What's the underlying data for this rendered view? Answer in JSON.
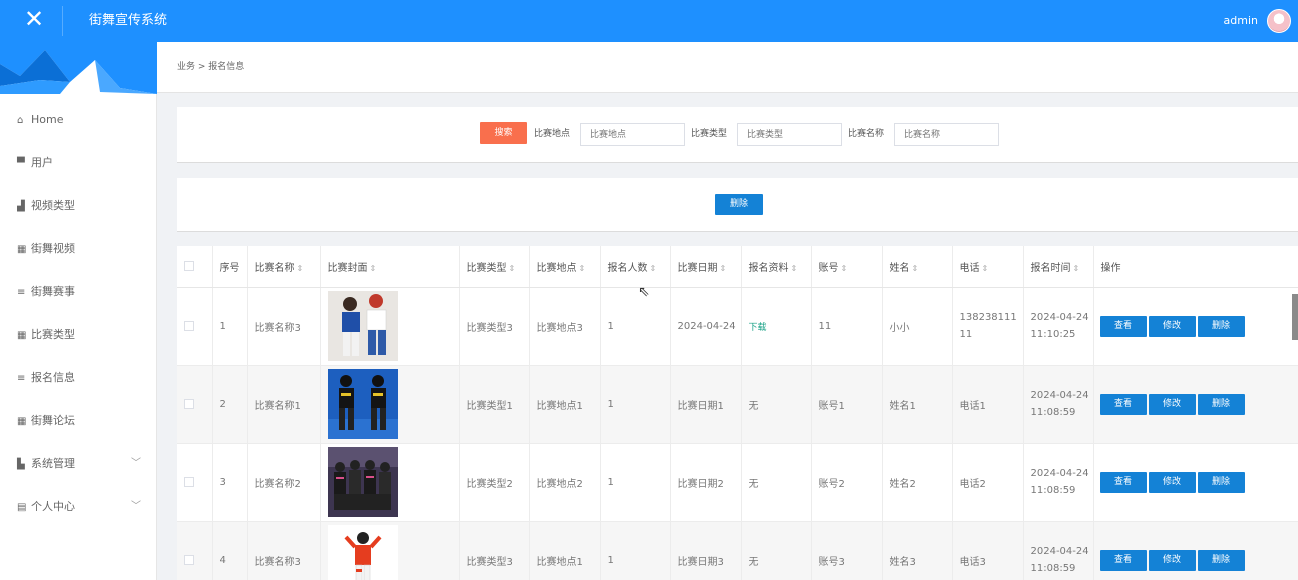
{
  "header": {
    "title": "街舞宣传系统",
    "username": "admin"
  },
  "sidebar": {
    "items": [
      {
        "label": "Home",
        "icon": "home-icon"
      },
      {
        "label": "用户",
        "icon": "chat-icon"
      },
      {
        "label": "视频类型",
        "icon": "bar-chart-icon"
      },
      {
        "label": "街舞视频",
        "icon": "grid-icon"
      },
      {
        "label": "街舞赛事",
        "icon": "list-icon"
      },
      {
        "label": "比赛类型",
        "icon": "grid-icon"
      },
      {
        "label": "报名信息",
        "icon": "list-icon"
      },
      {
        "label": "街舞论坛",
        "icon": "grid-icon"
      },
      {
        "label": "系统管理",
        "icon": "chart-icon",
        "expandable": true
      },
      {
        "label": "个人中心",
        "icon": "calendar-icon",
        "expandable": true
      }
    ]
  },
  "breadcrumb": "业务 > 报名信息",
  "search": {
    "button": "搜索",
    "fields": [
      {
        "label": "比赛地点",
        "placeholder": "比赛地点"
      },
      {
        "label": "比赛类型",
        "placeholder": "比赛类型"
      },
      {
        "label": "比赛名称",
        "placeholder": "比赛名称"
      }
    ]
  },
  "actions": {
    "delete": "删除"
  },
  "table": {
    "columns": [
      "序号",
      "比赛名称",
      "比赛封面",
      "比赛类型",
      "比赛地点",
      "报名人数",
      "比赛日期",
      "报名资料",
      "账号",
      "姓名",
      "电话",
      "报名时间",
      "操作"
    ],
    "row_buttons": [
      "查看",
      "修改",
      "删除"
    ],
    "rows": [
      {
        "no": "1",
        "name": "比赛名称3",
        "type": "比赛类型3",
        "place": "比赛地点3",
        "count": "1",
        "date": "2024-04-24",
        "material": "下载",
        "account": "11",
        "person": "小小",
        "phone1": "138238111",
        "phone2": "11",
        "time_date": "2024-04-24",
        "time_clock": "11:10:25"
      },
      {
        "no": "2",
        "name": "比赛名称1",
        "type": "比赛类型1",
        "place": "比赛地点1",
        "count": "1",
        "date": "比赛日期1",
        "material": "无",
        "account": "账号1",
        "person": "姓名1",
        "phone1": "电话1",
        "phone2": "",
        "time_date": "2024-04-24",
        "time_clock": "11:08:59"
      },
      {
        "no": "3",
        "name": "比赛名称2",
        "type": "比赛类型2",
        "place": "比赛地点2",
        "count": "1",
        "date": "比赛日期2",
        "material": "无",
        "account": "账号2",
        "person": "姓名2",
        "phone1": "电话2",
        "phone2": "",
        "time_date": "2024-04-24",
        "time_clock": "11:08:59"
      },
      {
        "no": "4",
        "name": "比赛名称3",
        "type": "比赛类型3",
        "place": "比赛地点1",
        "count": "1",
        "date": "比赛日期3",
        "material": "无",
        "account": "账号3",
        "person": "姓名3",
        "phone1": "电话3",
        "phone2": "",
        "time_date": "2024-04-24",
        "time_clock": "11:08:59"
      }
    ]
  },
  "colors": {
    "primary": "#1e90ff",
    "button_blue": "#1482d6",
    "search_orange": "#f96f4d",
    "download_green": "#16a085"
  }
}
